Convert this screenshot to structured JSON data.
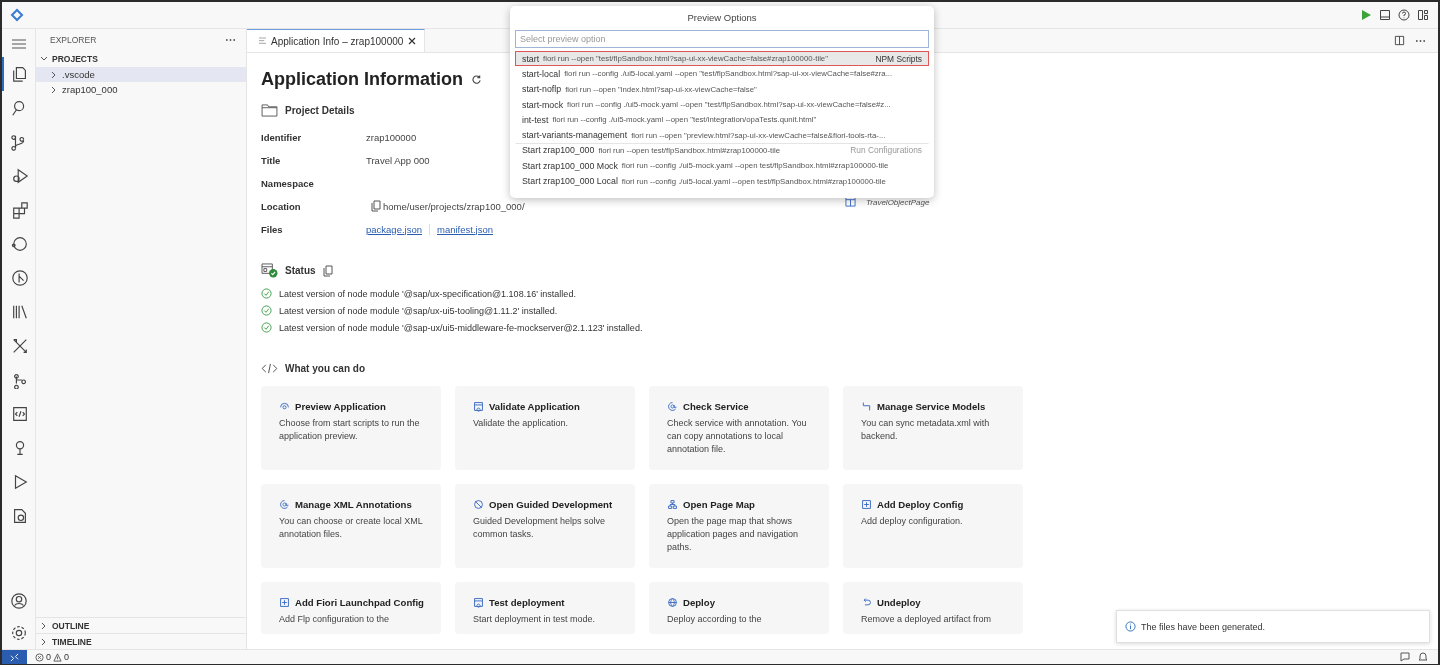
{
  "activity_bar": {
    "items": [
      {
        "selected": true
      },
      {
        "selected": false
      },
      {
        "selected": false
      },
      {
        "selected": false
      },
      {
        "selected": false
      },
      {
        "selected": false
      },
      {
        "selected": false
      },
      {
        "selected": false
      },
      {
        "selected": false
      },
      {
        "selected": false
      },
      {
        "selected": false
      },
      {
        "selected": false
      },
      {
        "selected": false
      },
      {
        "selected": false
      }
    ]
  },
  "sidebar": {
    "title": "EXPLORER",
    "section": {
      "title": "PROJECTS",
      "expanded": true,
      "children": [
        {
          "label": ".vscode",
          "expanded": false,
          "selected": true
        },
        {
          "label": "zrap100_000",
          "expanded": false,
          "selected": false
        }
      ]
    },
    "bottom_sections": [
      {
        "title": "OUTLINE",
        "expanded": false
      },
      {
        "title": "TIMELINE",
        "expanded": false
      }
    ]
  },
  "editor_tab": {
    "label": "Application Info – zrap100000",
    "selected": true
  },
  "page": {
    "title": "Application Information",
    "project_details": {
      "heading": "Project Details",
      "fields": [
        {
          "label": "Identifier",
          "value": "zrap100000"
        },
        {
          "label": "Title",
          "value": "Travel App 000"
        },
        {
          "label": "Namespace"
        },
        {
          "label": "Location",
          "value": "home/user/projects/zrap100_000/"
        },
        {
          "label": "Files",
          "links": [
            "package.json",
            "manifest.json"
          ]
        }
      ]
    },
    "status": {
      "heading": "Status",
      "items": [
        {
          "text": "Latest version of node module '@sap/ux-specification@1.108.16' installed.",
          "ok": true
        },
        {
          "text": "Latest version of node module '@sap/ux-ui5-tooling@1.11.2' installed.",
          "ok": true
        },
        {
          "text": "Latest version of node module '@sap-ux/ui5-middleware-fe-mockserver@2.1.123' installed.",
          "ok": true
        }
      ]
    },
    "actions": {
      "heading": "What you can do",
      "cards": [
        {
          "title": "Preview Application",
          "description": "Choose from start scripts to run the application preview."
        },
        {
          "title": "Validate Application",
          "description": "Validate the application."
        },
        {
          "title": "Check Service",
          "description": "Check service with annotation. You can copy annotations to local annotation file."
        },
        {
          "title": "Manage Service Models",
          "description": "You can sync metadata.xml with backend."
        },
        {
          "title": "Manage XML Annotations",
          "description": "You can choose or create local XML annotation files."
        },
        {
          "title": "Open Guided Development",
          "description": "Guided Development helps solve common tasks."
        },
        {
          "title": "Open Page Map",
          "description": "Open the page map that shows application pages and navigation paths."
        },
        {
          "title": "Add Deploy Config",
          "description": "Add deploy configuration."
        },
        {
          "title": "Add Fiori Launchpad Config",
          "description": "Add Flp configuration to the"
        },
        {
          "title": "Test deployment",
          "description": "Start deployment in test mode."
        },
        {
          "title": "Deploy",
          "description": "Deploy according to the"
        },
        {
          "title": "Undeploy",
          "description": "Remove a deployed artifact from"
        }
      ]
    },
    "page_map": {
      "entity": "TravelObjectPage"
    }
  },
  "preview_popup": {
    "title": "Preview Options",
    "placeholder": "Select preview option",
    "items": [
      {
        "name": "start",
        "detail": "fiori run --open \"test/flpSandbox.html?sap-ui-xx-viewCache=false#zrap100000-tile\"",
        "group": "NPM Scripts",
        "selected": true
      },
      {
        "name": "start-local",
        "detail": "fiori run --config ./ui5-local.yaml --open \"test/flpSandbox.html?sap-ui-xx-viewCache=false#zra...",
        "selected": false
      },
      {
        "name": "start-noflp",
        "detail": "fiori run --open \"index.html?sap-ui-xx-viewCache=false\"",
        "selected": false
      },
      {
        "name": "start-mock",
        "detail": "fiori run --config ./ui5-mock.yaml --open \"test/flpSandbox.html?sap-ui-xx-viewCache=false#z...",
        "selected": false
      },
      {
        "name": "int-test",
        "detail": "fiori run --config ./ui5-mock.yaml --open \"test/integration/opaTests.qunit.html\"",
        "selected": false
      },
      {
        "name": "start-variants-management",
        "detail": "fiori run --open \"preview.html?sap-ui-xx-viewCache=false&fiori-tools-rta-...",
        "selected": false
      },
      {
        "name": "Start zrap100_000",
        "detail": "fiori run --open test/flpSandbox.html#zrap100000-tile",
        "group": "Run Configurations",
        "selected": false
      },
      {
        "name": "Start zrap100_000 Mock",
        "detail": "fiori run --config ./ui5-mock.yaml --open test/flpSandbox.html#zrap100000-tile",
        "selected": false
      },
      {
        "name": "Start zrap100_000 Local",
        "detail": "fiori run --config ./ui5-local.yaml --open test/flpSandbox.html#zrap100000-tile",
        "selected": false
      }
    ]
  },
  "toast": {
    "text": "The files have been generated."
  },
  "status_bar": {
    "errors": "0",
    "warnings": "0"
  }
}
